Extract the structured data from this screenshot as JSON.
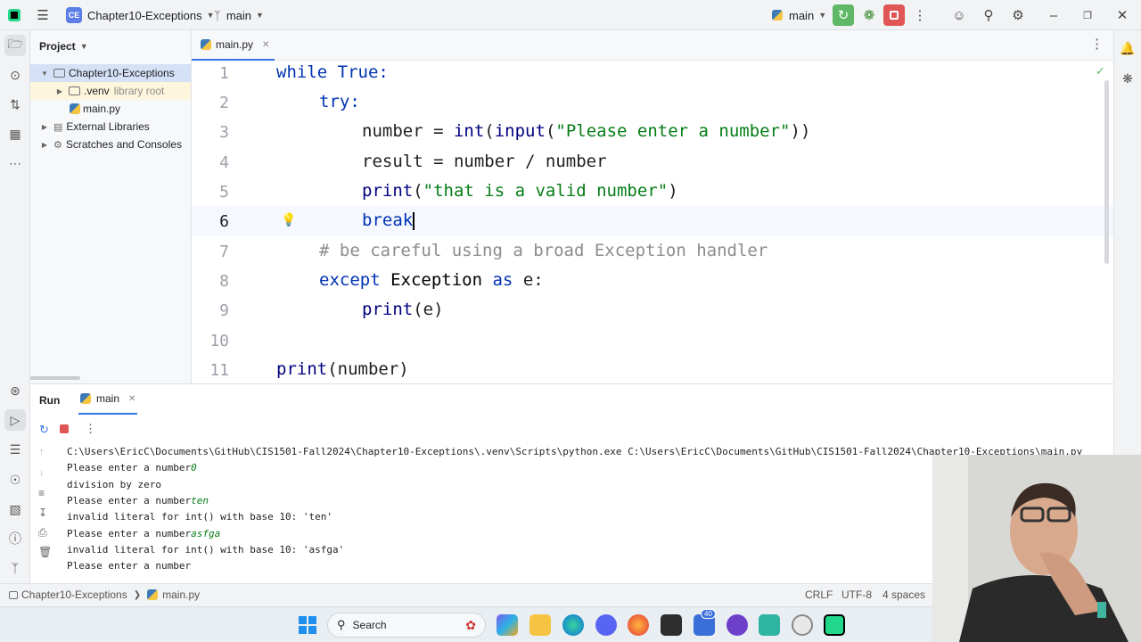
{
  "titlebar": {
    "project_badge": "CE",
    "project_name": "Chapter10-Exceptions",
    "branch": "main",
    "run_config": "main"
  },
  "project_panel": {
    "title": "Project",
    "root": "Chapter10-Exceptions",
    "venv": ".venv",
    "venv_hint": "library root",
    "main_file": "main.py",
    "external_libraries": "External Libraries",
    "scratches": "Scratches and Consoles"
  },
  "editor": {
    "tab_label": "main.py",
    "line_numbers": [
      "1",
      "2",
      "3",
      "4",
      "5",
      "6",
      "7",
      "8",
      "9",
      "10",
      "11"
    ],
    "current_line": "6"
  },
  "code": {
    "l1_kw": "while",
    "l1_rest": " True:",
    "l2_kw": "try:",
    "l3_a": "number = ",
    "l3_b": "int",
    "l3_c": "(",
    "l3_d": "input",
    "l3_e": "(",
    "l3_str": "\"Please enter a number\"",
    "l3_f": "))",
    "l4": "result = number / number",
    "l5_fn": "print",
    "l5_a": "(",
    "l5_str": "\"that is a valid number\"",
    "l5_b": ")",
    "l6_kw": "break",
    "l7_cm": "# be careful using a broad Exception handler",
    "l8_kw1": "except",
    "l8_cls": " Exception ",
    "l8_kw2": "as",
    "l8_rest": " e:",
    "l9_fn": "print",
    "l9_rest": "(e)",
    "l11_fn": "print",
    "l11_rest": "(number)"
  },
  "run_panel": {
    "tab_run": "Run",
    "tab_main": "main",
    "console": [
      {
        "text": "C:\\Users\\EricC\\Documents\\GitHub\\CIS1501-Fall2024\\Chapter10-Exceptions\\.venv\\Scripts\\python.exe C:\\Users\\EricC\\Documents\\GitHub\\CIS1501-Fall2024\\Chapter10-Exceptions\\main.py",
        "input": ""
      },
      {
        "text": "Please enter a number",
        "input": "0"
      },
      {
        "text": "division by zero",
        "input": ""
      },
      {
        "text": "Please enter a number",
        "input": "ten"
      },
      {
        "text": "invalid literal for int() with base 10: 'ten'",
        "input": ""
      },
      {
        "text": "Please enter a number",
        "input": "asfga"
      },
      {
        "text": "invalid literal for int() with base 10: 'asfga'",
        "input": ""
      },
      {
        "text": "Please enter a number",
        "input": ""
      }
    ]
  },
  "statusbar": {
    "crumb_project": "Chapter10-Exceptions",
    "crumb_file": "main.py",
    "line_sep": "CRLF",
    "encoding": "UTF-8",
    "indent": "4 spaces"
  },
  "taskbar": {
    "search_label": "Search",
    "badge_count": "40"
  },
  "colors": {
    "accent": "#3574f0",
    "run_green": "#5fb865",
    "stop_red": "#e05555",
    "keyword": "#0033b3",
    "string": "#067d17",
    "comment": "#8c8c8c"
  }
}
